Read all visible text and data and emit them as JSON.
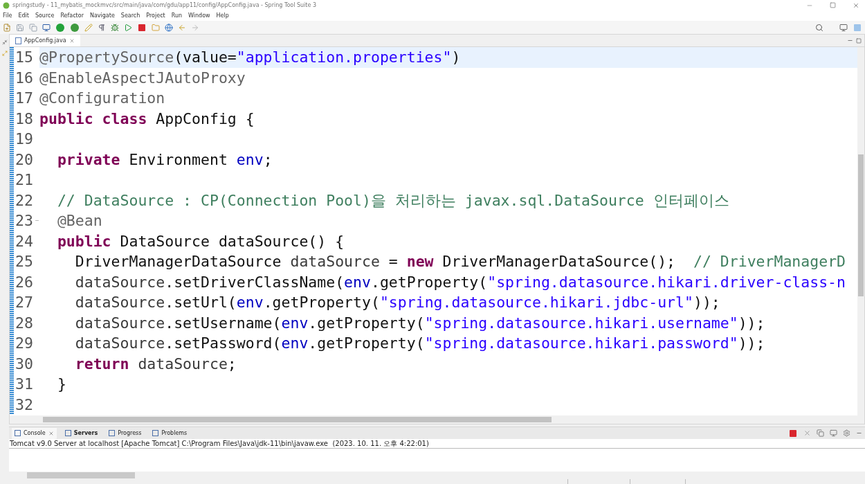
{
  "window": {
    "title": "springstudy - 11_mybatis_mockmvc/src/main/java/com/gdu/app11/config/AppConfig.java - Spring Tool Suite 3"
  },
  "menu": [
    "File",
    "Edit",
    "Source",
    "Refactor",
    "Navigate",
    "Search",
    "Project",
    "Run",
    "Window",
    "Help"
  ],
  "editor_tabs": [
    {
      "label": "AppConfig.java",
      "selected": true
    }
  ],
  "code_lines": [
    {
      "number": "15",
      "current": true,
      "foldable": false,
      "tokens": [
        {
          "kind": "annotation",
          "text": "@PropertySource"
        },
        {
          "kind": "plain",
          "text": "(value="
        },
        {
          "kind": "string",
          "text": "\"application.properties\""
        },
        {
          "kind": "plain",
          "text": ")"
        }
      ]
    },
    {
      "number": "16",
      "current": false,
      "foldable": false,
      "tokens": [
        {
          "kind": "annotation",
          "text": "@EnableAspectJAutoProxy"
        }
      ]
    },
    {
      "number": "17",
      "current": false,
      "foldable": false,
      "tokens": [
        {
          "kind": "annotation",
          "text": "@Configuration"
        }
      ]
    },
    {
      "number": "18",
      "current": false,
      "foldable": false,
      "tokens": [
        {
          "kind": "keyword",
          "text": "public class"
        },
        {
          "kind": "plain",
          "text": " AppConfig {"
        }
      ]
    },
    {
      "number": "19",
      "current": false,
      "foldable": false
    },
    {
      "number": "20",
      "current": false,
      "foldable": false,
      "tokens": [
        {
          "kind": "keyword",
          "text": "  private"
        },
        {
          "kind": "plain",
          "text": " Environment "
        },
        {
          "kind": "field",
          "text": "env"
        },
        {
          "kind": "plain",
          "text": ";"
        }
      ]
    },
    {
      "number": "21",
      "current": false,
      "foldable": false
    },
    {
      "number": "22",
      "current": false,
      "foldable": false,
      "tokens": [
        {
          "kind": "comment",
          "text": "  // DataSource : CP(Connection Pool)을 처리하는 javax.sql.DataSource 인터페이스"
        }
      ]
    },
    {
      "number": "23",
      "current": false,
      "foldable": true,
      "tokens": [
        {
          "kind": "annotation",
          "text": "  @Bean"
        }
      ]
    },
    {
      "number": "24",
      "current": false,
      "foldable": false,
      "tokens": [
        {
          "kind": "keyword",
          "text": "  public"
        },
        {
          "kind": "plain",
          "text": " DataSource dataSource() {"
        }
      ]
    },
    {
      "number": "25",
      "current": false,
      "foldable": false,
      "tokens": [
        {
          "kind": "plain",
          "text": "    DriverManagerDataSource "
        },
        {
          "kind": "local",
          "text": "dataSource"
        },
        {
          "kind": "plain",
          "text": " = "
        },
        {
          "kind": "keyword",
          "text": "new"
        },
        {
          "kind": "plain",
          "text": " DriverManagerDataSource();  "
        },
        {
          "kind": "comment",
          "text": "// DriverManagerD"
        }
      ]
    },
    {
      "number": "26",
      "current": false,
      "foldable": false,
      "tokens": [
        {
          "kind": "local",
          "text": "    dataSource"
        },
        {
          "kind": "plain",
          "text": ".setDriverClassName("
        },
        {
          "kind": "field",
          "text": "env"
        },
        {
          "kind": "plain",
          "text": ".getProperty("
        },
        {
          "kind": "string",
          "text": "\"spring.datasource.hikari.driver-class-n"
        }
      ]
    },
    {
      "number": "27",
      "current": false,
      "foldable": false,
      "tokens": [
        {
          "kind": "local",
          "text": "    dataSource"
        },
        {
          "kind": "plain",
          "text": ".setUrl("
        },
        {
          "kind": "field",
          "text": "env"
        },
        {
          "kind": "plain",
          "text": ".getProperty("
        },
        {
          "kind": "string",
          "text": "\"spring.datasource.hikari.jdbc-url\""
        },
        {
          "kind": "plain",
          "text": "));"
        }
      ]
    },
    {
      "number": "28",
      "current": false,
      "foldable": false,
      "tokens": [
        {
          "kind": "local",
          "text": "    dataSource"
        },
        {
          "kind": "plain",
          "text": ".setUsername("
        },
        {
          "kind": "field",
          "text": "env"
        },
        {
          "kind": "plain",
          "text": ".getProperty("
        },
        {
          "kind": "string",
          "text": "\"spring.datasource.hikari.username\""
        },
        {
          "kind": "plain",
          "text": "));"
        }
      ]
    },
    {
      "number": "29",
      "current": false,
      "foldable": false,
      "tokens": [
        {
          "kind": "local",
          "text": "    dataSource"
        },
        {
          "kind": "plain",
          "text": ".setPassword("
        },
        {
          "kind": "field",
          "text": "env"
        },
        {
          "kind": "plain",
          "text": ".getProperty("
        },
        {
          "kind": "string",
          "text": "\"spring.datasource.hikari.password\""
        },
        {
          "kind": "plain",
          "text": "));"
        }
      ]
    },
    {
      "number": "30",
      "current": false,
      "foldable": false,
      "tokens": [
        {
          "kind": "keyword",
          "text": "    return"
        },
        {
          "kind": "local",
          "text": " dataSource"
        },
        {
          "kind": "plain",
          "text": ";"
        }
      ]
    },
    {
      "number": "31",
      "current": false,
      "foldable": false,
      "tokens": [
        {
          "kind": "plain",
          "text": "  }"
        }
      ]
    },
    {
      "number": "32",
      "current": false,
      "foldable": false
    }
  ],
  "console_tabs": [
    {
      "label": "Console",
      "selected": true,
      "bold": false,
      "closable": true
    },
    {
      "label": "Servers",
      "selected": false,
      "bold": true,
      "closable": false
    },
    {
      "label": "Progress",
      "selected": false,
      "bold": false,
      "closable": false
    },
    {
      "label": "Problems",
      "selected": false,
      "bold": false,
      "closable": false
    }
  ],
  "console_header": "Tomcat v9.0 Server at localhost [Apache Tomcat] C:\\Program Files\\Java\\jdk-11\\bin\\javaw.exe  (2023. 10. 11. 오후 4:22:01)"
}
